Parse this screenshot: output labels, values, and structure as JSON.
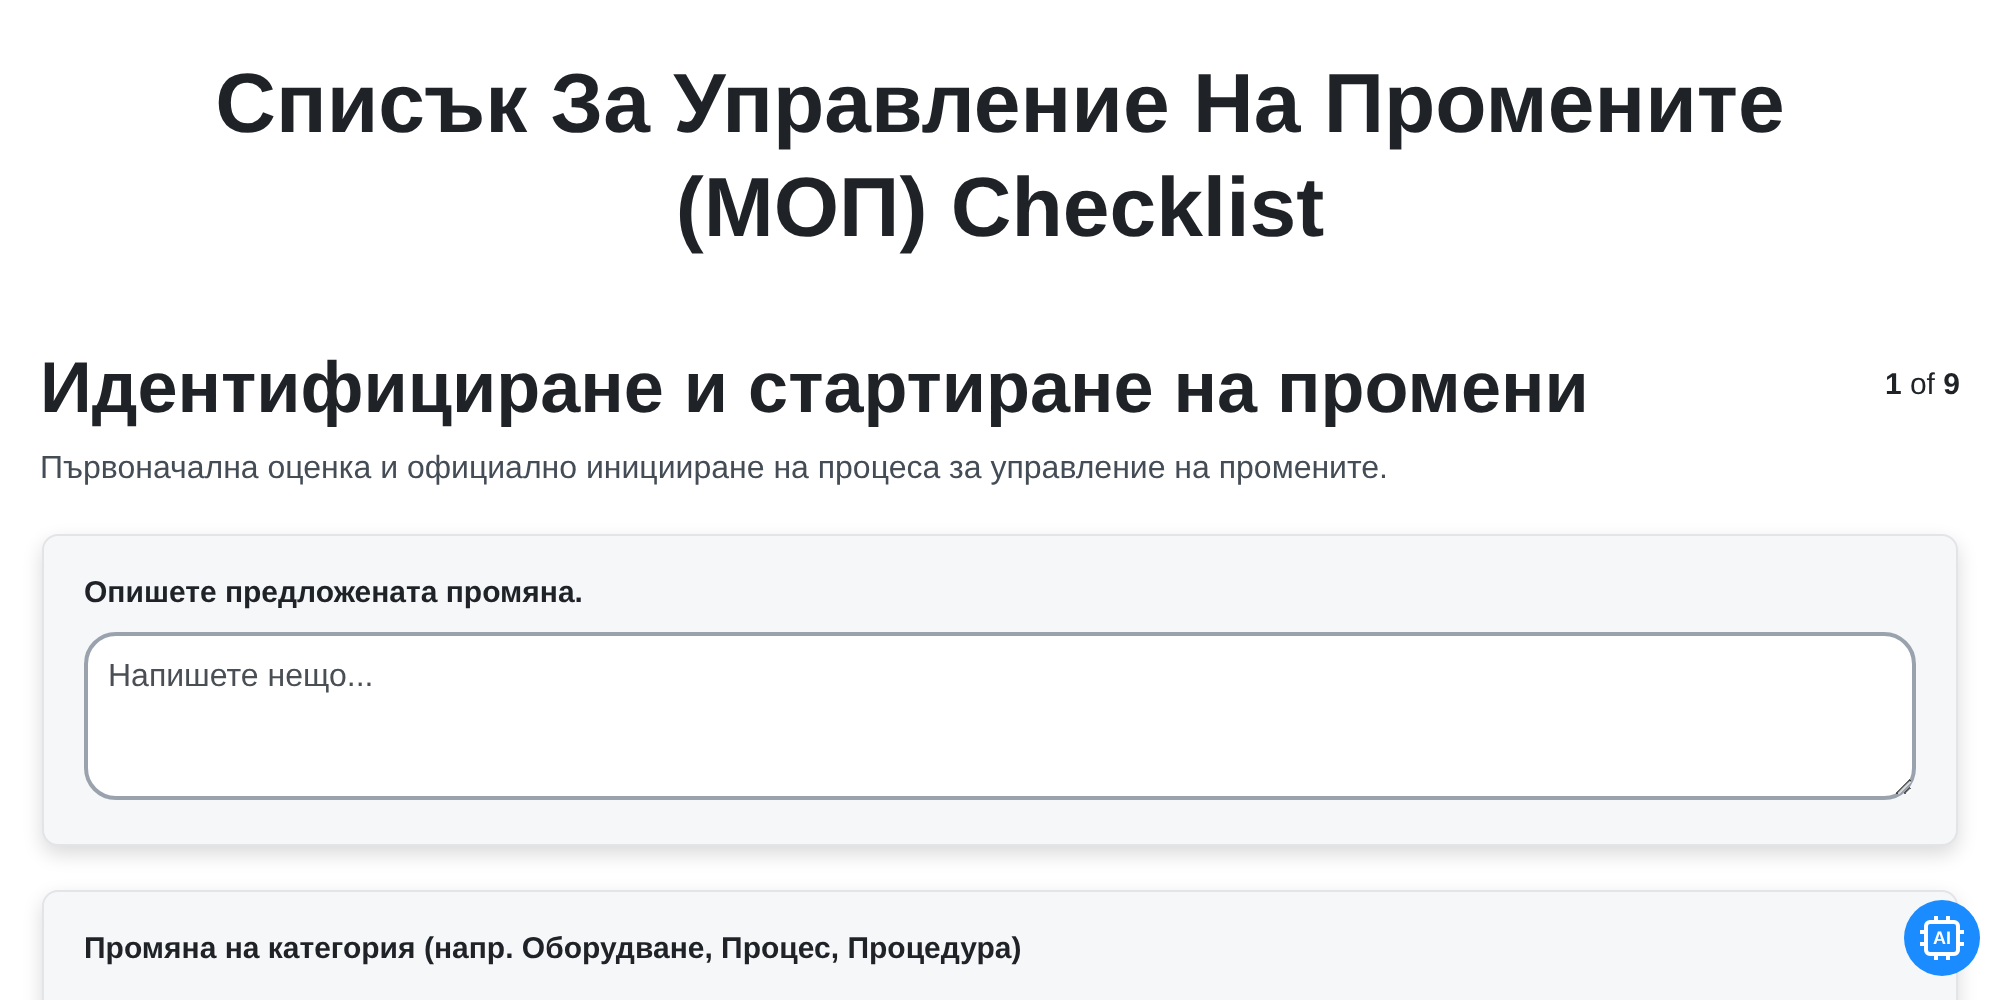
{
  "title": "Списък За Управление На Промените (МОП) Checklist",
  "section": {
    "heading": "Идентифициране и стартиране на промени",
    "counter": "**1** of **9**",
    "description": "Първоначална оценка и официално иницииране на процеса за управление на промените."
  },
  "questions": [
    {
      "label": "Опишете предложената промяна.",
      "kind": "textarea",
      "placeholder": "Напишете нещо..."
    },
    {
      "label": "Промяна на категория (напр. Оборудване, Процес, Процедура)",
      "kind": "cut"
    }
  ],
  "ai_button": {
    "label": "AI"
  }
}
